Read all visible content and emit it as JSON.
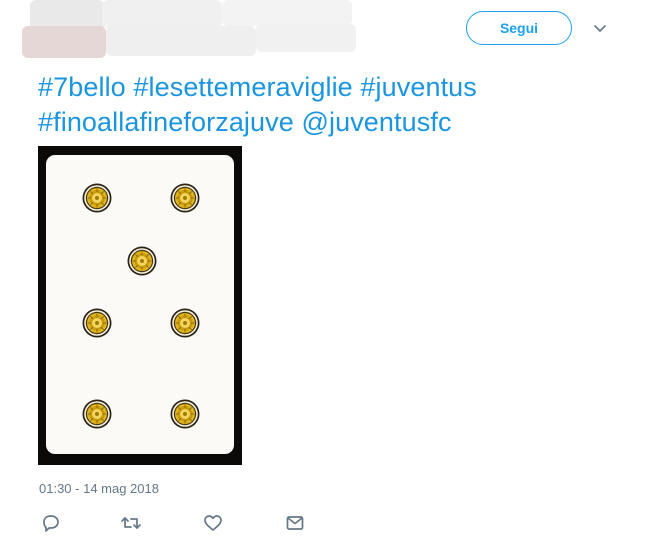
{
  "header": {
    "follow_label": "Segui",
    "menu_icon": "chevron-down-icon"
  },
  "tweet": {
    "lines": [
      [
        "#7bello",
        "#lesettemeraviglie",
        "#juventus"
      ],
      [
        "#finoallafineforzajuve",
        "@juventusfc"
      ]
    ],
    "timestamp": "01:30 - 14 mag 2018"
  },
  "media": {
    "description_icon": "playing-card-seven-of-coins"
  },
  "actions": [
    {
      "name": "reply-icon"
    },
    {
      "name": "retweet-icon"
    },
    {
      "name": "like-icon"
    },
    {
      "name": "direct-message-icon"
    }
  ],
  "colors": {
    "accent": "#1da1f2",
    "link": "#1b95e0",
    "muted": "#657786",
    "coin_gold": "#e0b51a"
  }
}
